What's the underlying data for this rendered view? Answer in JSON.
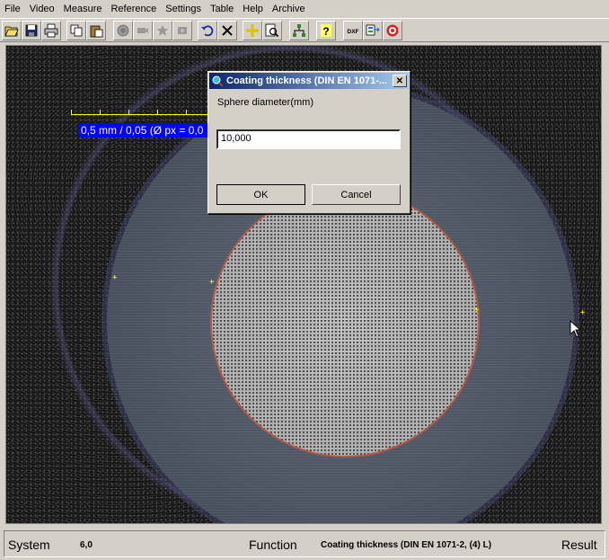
{
  "menu": [
    "File",
    "Video",
    "Measure",
    "Reference",
    "Settings",
    "Table",
    "Help",
    "Archive"
  ],
  "toolbar": {
    "icons": [
      "open-icon",
      "save-icon",
      "print-icon",
      "copy-icon",
      "paste-icon",
      "camera-icon",
      "video-icon",
      "capture-icon",
      "record-icon",
      "undo-icon",
      "delete-icon",
      "crosshair-icon",
      "zoom-icon",
      "network-icon",
      "help-icon",
      "dxf-icon",
      "export-icon",
      "settings-gear-icon"
    ],
    "dxf_label": "DXF"
  },
  "image": {
    "scale_text": "0,5 mm / 0,05 (Ø px = 0,0"
  },
  "dialog": {
    "title": "Coating thickness (DIN EN 1071-...",
    "label": "Sphere diameter(mm)",
    "value": "10,000",
    "ok": "OK",
    "cancel": "Cancel"
  },
  "status": {
    "system_label": "System",
    "system_value": "6,0",
    "function_label": "Function",
    "function_value": "Coating thickness (DIN EN 1071-2, (4) L)",
    "result_label": "Result"
  }
}
